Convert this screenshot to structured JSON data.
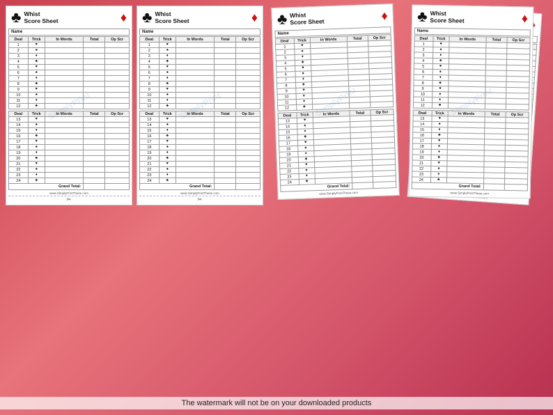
{
  "title": "Whist Score Sheet",
  "sheets": {
    "header": {
      "title_line1": "Whist",
      "title_line2": "Score Sheet"
    },
    "columns": {
      "deal": "Deal",
      "trick": "Trick",
      "inwords": "In Words",
      "total": "Total",
      "opscr": "Op Scr"
    },
    "name_label": "Name",
    "grand_total": "Grand Total:",
    "website": "www.SimplyPrintThese.com",
    "bottom_text": "The watermark will not be on your downloaded products",
    "deals_part1": [
      {
        "num": 1,
        "suit": "♥",
        "color": "red"
      },
      {
        "num": 2,
        "suit": "♠",
        "color": "black"
      },
      {
        "num": 3,
        "suit": "♦",
        "color": "red"
      },
      {
        "num": 4,
        "suit": "♣",
        "color": "black"
      },
      {
        "num": 5,
        "suit": "♥",
        "color": "red"
      },
      {
        "num": 6,
        "suit": "♠",
        "color": "black"
      },
      {
        "num": 7,
        "suit": "♦",
        "color": "red"
      },
      {
        "num": 8,
        "suit": "♣",
        "color": "black"
      },
      {
        "num": 9,
        "suit": "♥",
        "color": "red"
      },
      {
        "num": 10,
        "suit": "♠",
        "color": "black"
      },
      {
        "num": 11,
        "suit": "♦",
        "color": "red"
      },
      {
        "num": 12,
        "suit": "♣",
        "color": "black"
      }
    ],
    "deals_part2": [
      {
        "num": 13,
        "suit": "♥",
        "color": "red"
      },
      {
        "num": 14,
        "suit": "♠",
        "color": "black"
      },
      {
        "num": 15,
        "suit": "♦",
        "color": "red"
      },
      {
        "num": 16,
        "suit": "♣",
        "color": "black"
      },
      {
        "num": 17,
        "suit": "♥",
        "color": "red"
      },
      {
        "num": 18,
        "suit": "♠",
        "color": "black"
      },
      {
        "num": 19,
        "suit": "♦",
        "color": "red"
      },
      {
        "num": 20,
        "suit": "♣",
        "color": "black"
      },
      {
        "num": 21,
        "suit": "♥",
        "color": "red"
      },
      {
        "num": 22,
        "suit": "♠",
        "color": "black"
      },
      {
        "num": 23,
        "suit": "♦",
        "color": "red"
      },
      {
        "num": 24,
        "suit": "♣",
        "color": "black"
      }
    ]
  }
}
